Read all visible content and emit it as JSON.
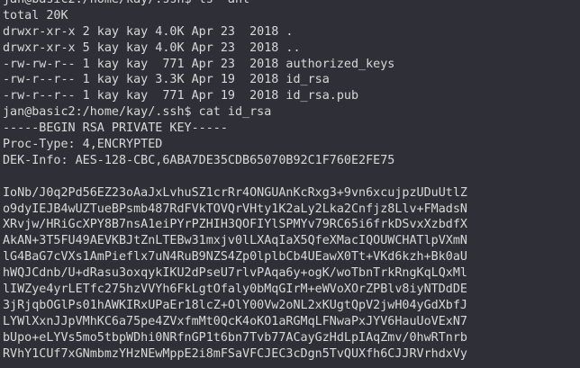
{
  "terminal": {
    "lines": [
      "jan@basic2:/home/kay/.ssh$ ls -ahl",
      "total 20K",
      "drwxr-xr-x 2 kay kay 4.0K Apr 23  2018 .",
      "drwxr-xr-x 5 kay kay 4.0K Apr 23  2018 ..",
      "-rw-rw-r-- 1 kay kay  771 Apr 23  2018 authorized_keys",
      "-rw-r--r-- 1 kay kay 3.3K Apr 19  2018 id_rsa",
      "-rw-r--r-- 1 kay kay  771 Apr 19  2018 id_rsa.pub",
      "jan@basic2:/home/kay/.ssh$ cat id_rsa",
      "-----BEGIN RSA PRIVATE KEY-----",
      "Proc-Type: 4,ENCRYPTED",
      "DEK-Info: AES-128-CBC,6ABA7DE35CDB65070B92C1F760E2FE75",
      "",
      "IoNb/J0q2Pd56EZ23oAaJxLvhuSZ1crRr4ONGUAnKcRxg3+9vn6xcujpzUDuUtlZ",
      "o9dyIEJB4wUZTueBPsmb487RdFVkTOVQrVHty1K2aLy2Lka2Cnfjz8Llv+FMadsN",
      "XRvjw/HRiGcXPY8B7nsA1eiPYrPZHIH3QOFIYlSPMYv79RC65i6frkDSvxXzbdfX",
      "AkAN+3T5FU49AEVKBJtZnLTEBw31mxjv0lLXAqIaX5QfeXMacIQOUWCHATlpVXmN",
      "lG4BaG7cVXs1AmPieflx7uN4RuB9NZS4Zp0lplbCb4UEawX0Tt+VKd6kzh+Bk0aU",
      "hWQJCdnb/U+dRasu3oxqykIKU2dPseU7rlvPAqa6y+ogK/woTbnTrkRngKqLQxMl",
      "lIWZye4yrLETfc275hzVVYh6FkLgtOfaly0bMqGIrM+eWVoXOrZPBlv8iyNTDdDE",
      "3jRjqbOGlPs01hAWKIRxUPaEr18lcZ+OlY00Vw2oNL2xKUgtQpV2jwH04yGdXbfJ",
      "LYWlXxnJJpVMhKC6a75pe4ZVxfmMt0QcK4oKO1aRGMqLFNwaPxJYV6HauUoVExN7",
      "bUpo+eLYVs5mo5tbpWDhi0NRfnGP1t6bn7Tvb77ACayGzHdLpIAqZmv/0hwRTnrb",
      "RVhY1CUf7xGNmbmzYHzNEwMppE2i8mFSaVFCJEC3cDgn5TvQUXfh6CJJRVrhdxVy"
    ]
  }
}
